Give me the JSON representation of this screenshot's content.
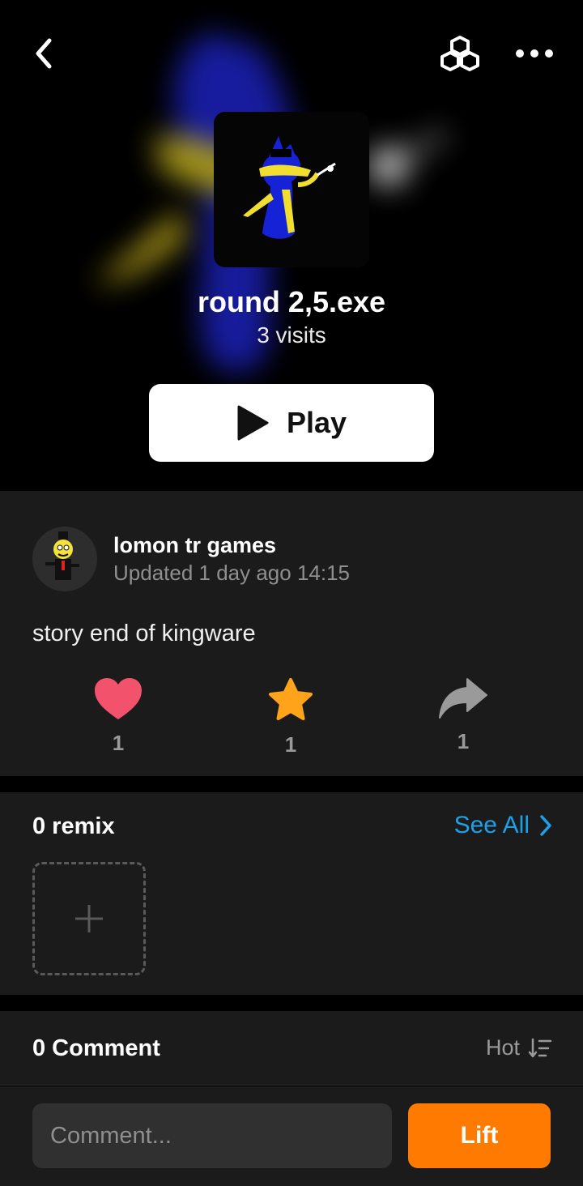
{
  "header": {
    "back_icon": "chevron-left-icon",
    "blocks_icon": "cubes-icon",
    "more_icon": "more-horizontal-icon"
  },
  "game": {
    "title": "round 2,5.exe",
    "visits": "3 visits",
    "play_label": "Play"
  },
  "author": {
    "name": "lomon tr games",
    "updated": "Updated 1 day ago 14:15"
  },
  "description": "story end of kingware",
  "actions": {
    "like_count": "1",
    "favorite_count": "1",
    "share_count": "1"
  },
  "remix": {
    "title": "0 remix",
    "see_all": "See All"
  },
  "comments": {
    "title": "0 Comment",
    "sort_label": "Hot"
  },
  "composer": {
    "placeholder": "Comment...",
    "submit_label": "Lift"
  },
  "colors": {
    "like": "#f2526c",
    "favorite": "#ffa31a",
    "share": "#9a9a9a",
    "link": "#1ea0e8",
    "lift": "#ff7a00"
  }
}
